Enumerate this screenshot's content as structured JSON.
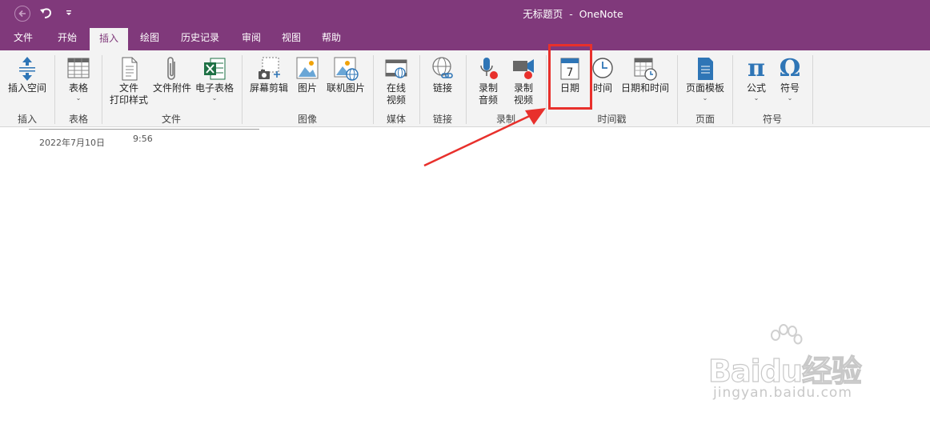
{
  "window": {
    "title": "无标题页  -  OneNote"
  },
  "quick_access": {
    "back_icon": "back-circle-icon",
    "undo_icon": "undo-icon",
    "customize_icon": "customize-qat-icon"
  },
  "tabs": [
    {
      "label": "文件",
      "active": false
    },
    {
      "label": "开始",
      "active": false
    },
    {
      "label": "插入",
      "active": true
    },
    {
      "label": "绘图",
      "active": false
    },
    {
      "label": "历史记录",
      "active": false
    },
    {
      "label": "审阅",
      "active": false
    },
    {
      "label": "视图",
      "active": false
    },
    {
      "label": "帮助",
      "active": false
    }
  ],
  "ribbon": {
    "groups": {
      "insert": "插入",
      "table": "表格",
      "file": "文件",
      "image": "图像",
      "media": "媒体",
      "link": "链接",
      "record": "录制",
      "timestamp": "时间戳",
      "page": "页面",
      "symbol": "符号"
    },
    "buttons": {
      "insert_space": "插入空间",
      "table": "表格",
      "file_printout": "文件\n打印样式",
      "file_attachment": "文件附件",
      "spreadsheet": "电子表格",
      "screen_clipping": "屏幕剪辑",
      "picture": "图片",
      "online_picture": "联机图片",
      "online_video": "在线\n视频",
      "link": "链接",
      "record_audio": "录制\n音频",
      "record_video": "录制\n视频",
      "date": "日期",
      "time": "时间",
      "date_time": "日期和时间",
      "page_templates": "页面模板",
      "equation": "公式",
      "symbol": "符号"
    },
    "dropdown_chevron": "⌄",
    "calendar_digit": "7",
    "pi_glyph": "π",
    "omega_glyph": "Ω"
  },
  "page": {
    "date": "2022年7月10日",
    "time": "9:56"
  },
  "watermark": {
    "brand": "Baidu经验",
    "url": "jingyan.baidu.com"
  },
  "colors": {
    "accent": "#80397b",
    "ribbon_bg": "#f3f3f3",
    "highlight": "#e8302c",
    "icon_blue": "#2e75b6"
  }
}
